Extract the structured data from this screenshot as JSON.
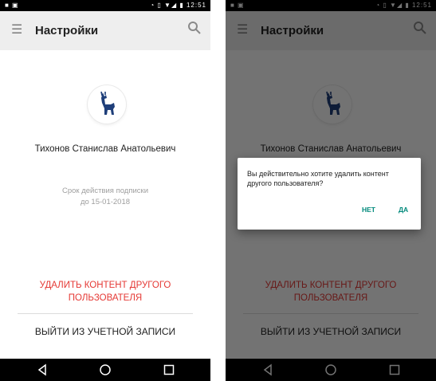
{
  "status_bar": {
    "time": "12:51",
    "left_icons": "■ ▣",
    "right_icons": "◔ ▯ ▼◢ ▮"
  },
  "appbar": {
    "title": "Настройки",
    "menu_icon": "menu-icon",
    "search_icon": "search-icon"
  },
  "profile": {
    "name": "Тихонов Станислав Анатольевич",
    "subscription_line1": "Срок действия подписки",
    "subscription_line2": "до 15-01-2018"
  },
  "actions": {
    "delete_line1": "УДАЛИТЬ КОНТЕНТ ДРУГОГО",
    "delete_line2": "ПОЛЬЗОВАТЕЛЯ",
    "logout": "ВЫЙТИ ИЗ УЧЕТНОЙ ЗАПИСИ"
  },
  "dialog": {
    "message": "Вы действительно хотите удалить контент другого пользователя?",
    "no": "НЕТ",
    "yes": "ДА"
  },
  "colors": {
    "accent_red": "#e53935",
    "dialog_button": "#00897b",
    "logo_blue": "#1f3f7a"
  }
}
